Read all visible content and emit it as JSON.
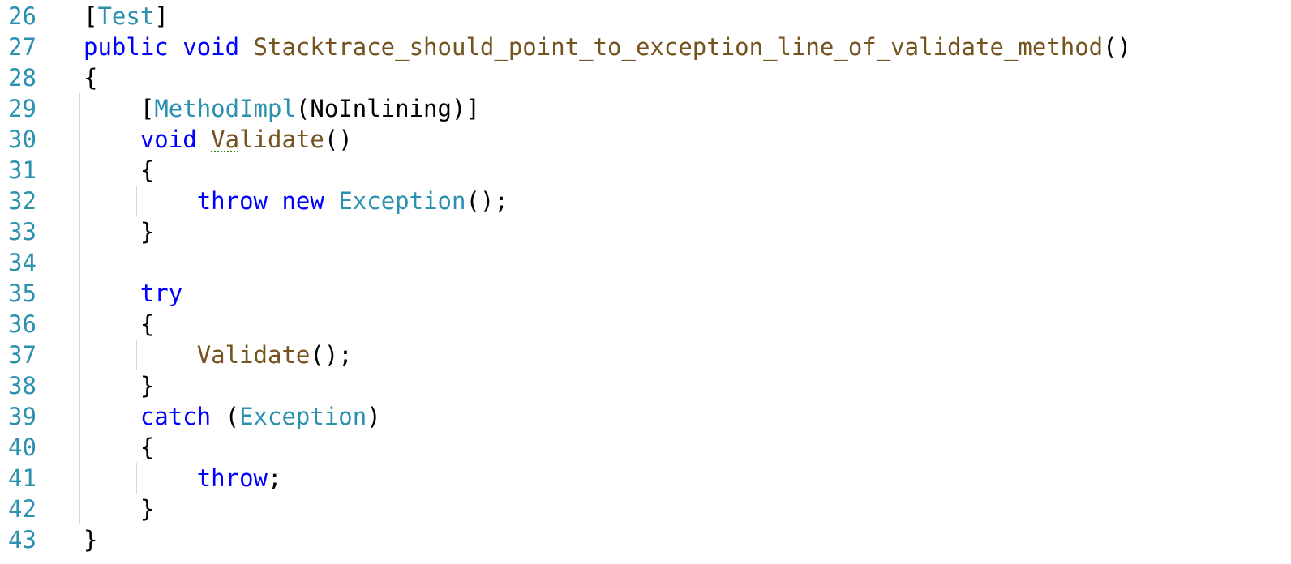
{
  "editor": {
    "lines": [
      {
        "number": "26",
        "tokens": [
          [
            "pn",
            "["
          ],
          [
            "ty",
            "Test"
          ],
          [
            "pn",
            "]"
          ]
        ]
      },
      {
        "number": "27",
        "tokens": [
          [
            "kw",
            "public"
          ],
          [
            "pn",
            " "
          ],
          [
            "kw",
            "void"
          ],
          [
            "pn",
            " "
          ],
          [
            "fn",
            "Stacktrace_should_point_to_exception_line_of_validate_method"
          ],
          [
            "pn",
            "()"
          ]
        ]
      },
      {
        "number": "28",
        "tokens": [
          [
            "pn",
            "{"
          ]
        ]
      },
      {
        "number": "29",
        "tokens": [
          [
            "pn",
            "    ["
          ],
          [
            "ty",
            "MethodImpl"
          ],
          [
            "pn",
            "(NoInlining)]"
          ]
        ]
      },
      {
        "number": "30",
        "tokens": [
          [
            "pn",
            "    "
          ],
          [
            "kw",
            "void"
          ],
          [
            "pn",
            " "
          ],
          [
            "fn-sq",
            "Va"
          ],
          [
            "fn",
            "lidate"
          ],
          [
            "pn",
            "()"
          ]
        ]
      },
      {
        "number": "31",
        "tokens": [
          [
            "pn",
            "    {"
          ]
        ]
      },
      {
        "number": "32",
        "tokens": [
          [
            "pn",
            "        "
          ],
          [
            "kw",
            "throw"
          ],
          [
            "pn",
            " "
          ],
          [
            "kw",
            "new"
          ],
          [
            "pn",
            " "
          ],
          [
            "ty",
            "Exception"
          ],
          [
            "pn",
            "();"
          ]
        ]
      },
      {
        "number": "33",
        "tokens": [
          [
            "pn",
            "    }"
          ]
        ]
      },
      {
        "number": "34",
        "tokens": []
      },
      {
        "number": "35",
        "tokens": [
          [
            "pn",
            "    "
          ],
          [
            "kw",
            "try"
          ]
        ]
      },
      {
        "number": "36",
        "tokens": [
          [
            "pn",
            "    {"
          ]
        ]
      },
      {
        "number": "37",
        "tokens": [
          [
            "pn",
            "        "
          ],
          [
            "fn",
            "Validate"
          ],
          [
            "pn",
            "();"
          ]
        ]
      },
      {
        "number": "38",
        "tokens": [
          [
            "pn",
            "    }"
          ]
        ]
      },
      {
        "number": "39",
        "tokens": [
          [
            "pn",
            "    "
          ],
          [
            "kw",
            "catch"
          ],
          [
            "pn",
            " ("
          ],
          [
            "ty",
            "Exception"
          ],
          [
            "pn",
            ")"
          ]
        ]
      },
      {
        "number": "40",
        "tokens": [
          [
            "pn",
            "    {"
          ]
        ]
      },
      {
        "number": "41",
        "tokens": [
          [
            "pn",
            "        "
          ],
          [
            "kw",
            "throw"
          ],
          [
            "pn",
            ";"
          ]
        ]
      },
      {
        "number": "42",
        "tokens": [
          [
            "pn",
            "    }"
          ]
        ]
      },
      {
        "number": "43",
        "tokens": [
          [
            "pn",
            "}"
          ]
        ]
      }
    ]
  },
  "colors": {
    "line_number": "#2b91af",
    "keyword": "#0000ff",
    "type": "#2b91af",
    "method": "#74531f",
    "punctuation": "#000000",
    "squiggle": "#2e8b00",
    "indent_guide": "#d6d6d6"
  }
}
